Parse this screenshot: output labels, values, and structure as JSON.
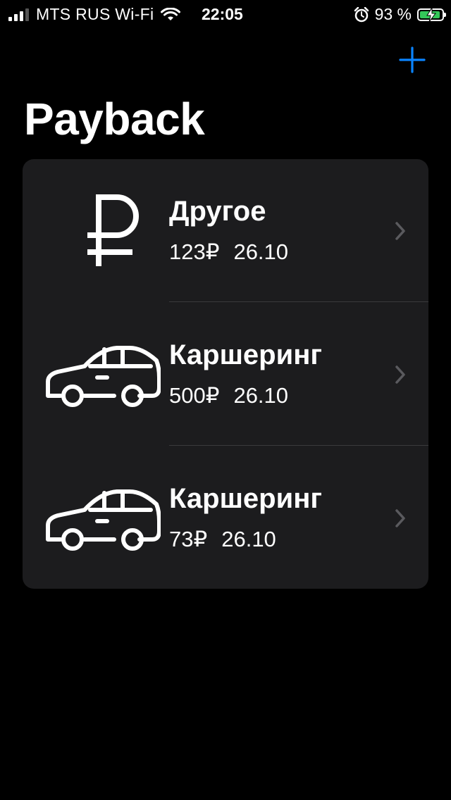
{
  "status_bar": {
    "carrier": "MTS RUS Wi-Fi",
    "time": "22:05",
    "battery_percent": "93 %",
    "battery_level": 0.93,
    "signal_bars": 4,
    "signal_active": 3
  },
  "header": {
    "title": "Payback",
    "add_icon": "plus-icon"
  },
  "colors": {
    "accent": "#0a84ff",
    "background": "#000000",
    "card": "#1c1c1e",
    "battery": "#34c759"
  },
  "expenses": [
    {
      "icon": "ruble-icon",
      "title": "Другое",
      "amount": "123₽",
      "date": "26.10"
    },
    {
      "icon": "car-icon",
      "title": "Каршеринг",
      "amount": "500₽",
      "date": "26.10"
    },
    {
      "icon": "car-icon",
      "title": "Каршеринг",
      "amount": "73₽",
      "date": "26.10"
    }
  ]
}
